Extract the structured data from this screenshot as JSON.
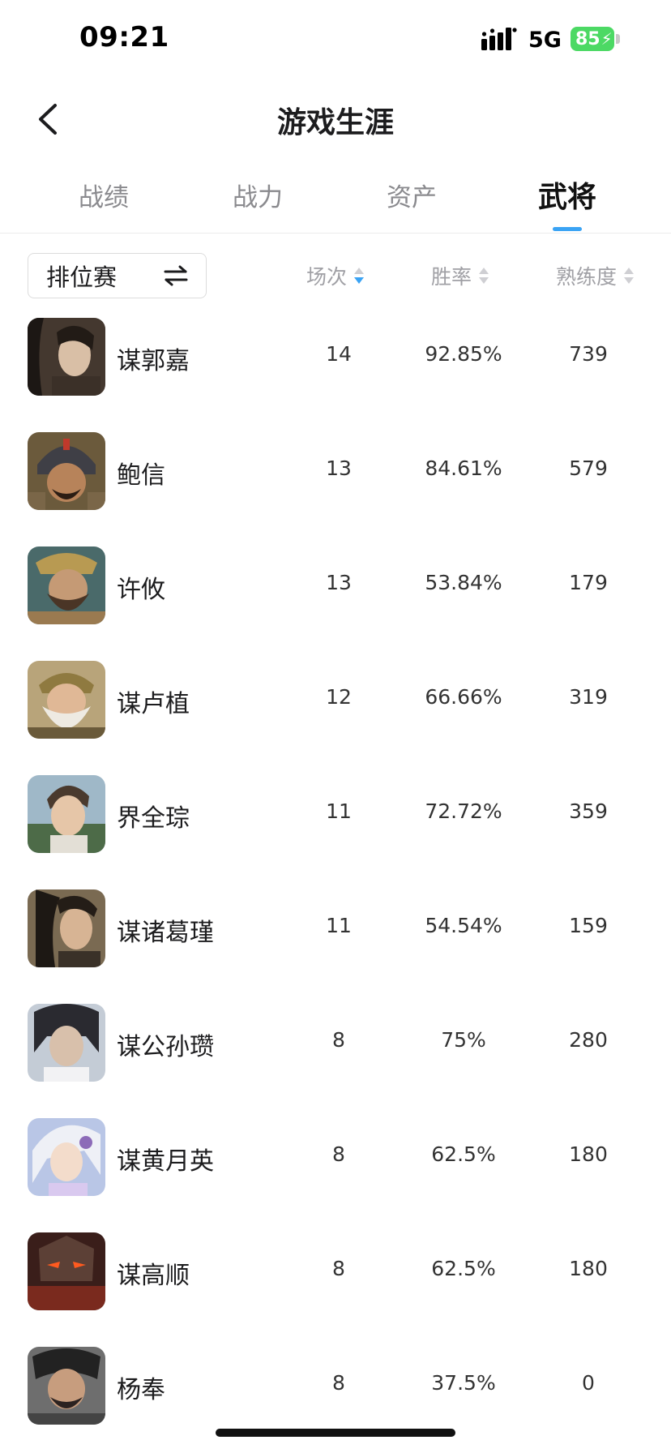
{
  "status_bar": {
    "time": "09:21",
    "network": "5G",
    "battery": "85"
  },
  "header": {
    "title": "游戏生涯",
    "back_icon": "chevron-left-icon"
  },
  "tabs": [
    {
      "label": "战绩",
      "active": false
    },
    {
      "label": "战力",
      "active": false
    },
    {
      "label": "资产",
      "active": false
    },
    {
      "label": "武将",
      "active": true
    }
  ],
  "filter": {
    "mode": "排位赛",
    "swap_icon": "swap-arrows-icon"
  },
  "columns": {
    "matches": "场次",
    "win_rate": "胜率",
    "proficiency": "熟练度"
  },
  "colors": {
    "accent": "#3aa3f4",
    "battery": "#4cd964"
  },
  "generals": [
    {
      "name": "谋郭嘉",
      "matches": "14",
      "win_rate": "92.85%",
      "proficiency": "739"
    },
    {
      "name": "鲍信",
      "matches": "13",
      "win_rate": "84.61%",
      "proficiency": "579"
    },
    {
      "name": "许攸",
      "matches": "13",
      "win_rate": "53.84%",
      "proficiency": "179"
    },
    {
      "name": "谋卢植",
      "matches": "12",
      "win_rate": "66.66%",
      "proficiency": "319"
    },
    {
      "name": "界全琮",
      "matches": "11",
      "win_rate": "72.72%",
      "proficiency": "359"
    },
    {
      "name": "谋诸葛瑾",
      "matches": "11",
      "win_rate": "54.54%",
      "proficiency": "159"
    },
    {
      "name": "谋公孙瓒",
      "matches": "8",
      "win_rate": "75%",
      "proficiency": "280"
    },
    {
      "name": "谋黄月英",
      "matches": "8",
      "win_rate": "62.5%",
      "proficiency": "180"
    },
    {
      "name": "谋高顺",
      "matches": "8",
      "win_rate": "62.5%",
      "proficiency": "180"
    },
    {
      "name": "杨奉",
      "matches": "8",
      "win_rate": "37.5%",
      "proficiency": "0"
    }
  ]
}
